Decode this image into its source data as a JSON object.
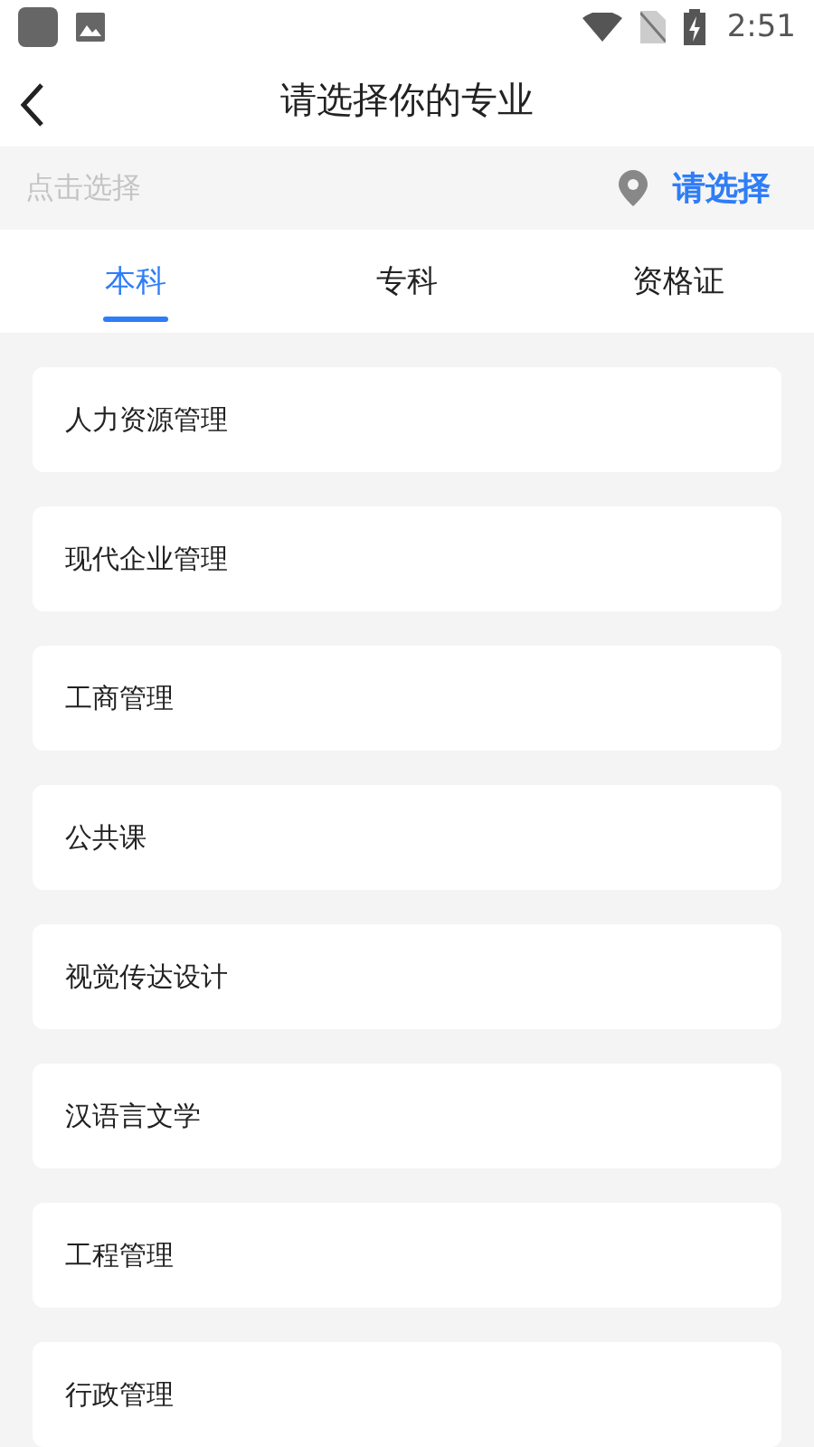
{
  "status_bar": {
    "time": "2:51"
  },
  "header": {
    "title": "请选择你的专业"
  },
  "search": {
    "placeholder": "点击选择",
    "action": "请选择"
  },
  "tabs": [
    {
      "label": "本科",
      "selected": true
    },
    {
      "label": "专科",
      "selected": false
    },
    {
      "label": "资格证",
      "selected": false
    }
  ],
  "majors": [
    "人力资源管理",
    "现代企业管理",
    "工商管理",
    "公共课",
    "视觉传达设计",
    "汉语言文学",
    "工程管理",
    "行政管理"
  ]
}
